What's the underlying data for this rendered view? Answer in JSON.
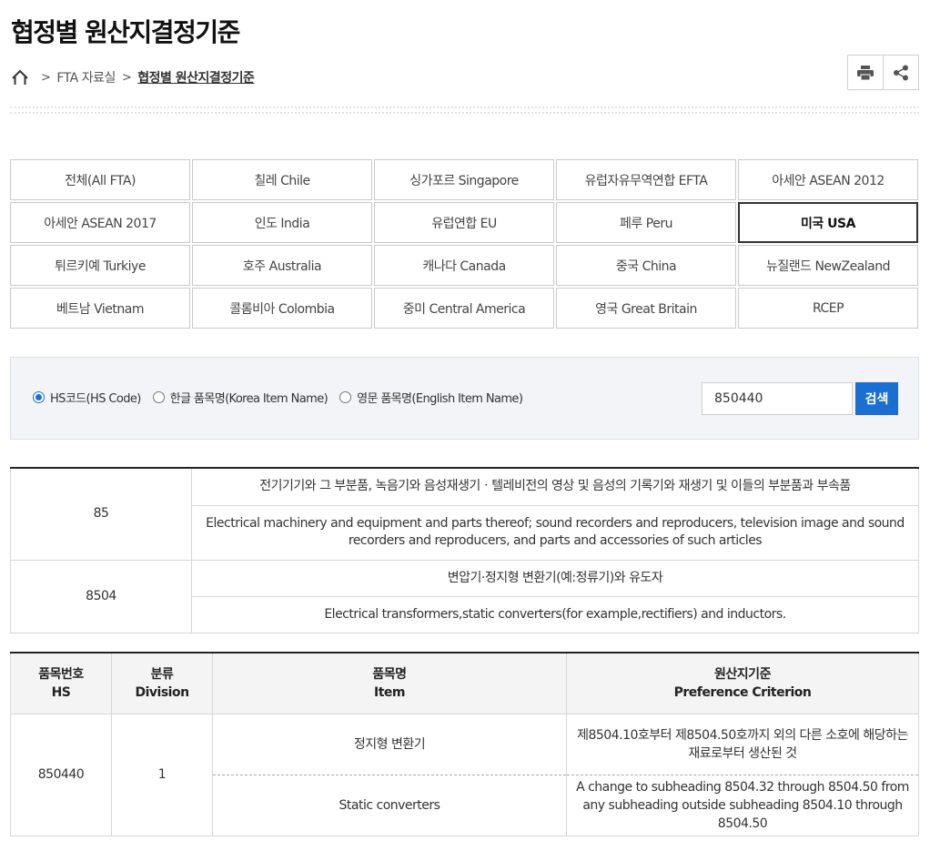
{
  "page_title": "협정별 원산지결정기준",
  "breadcrumb": {
    "home_icon": "home-icon",
    "level1": "FTA 자료실",
    "current": "협정별 원산지결정기준"
  },
  "tools": {
    "print_icon": "print-icon",
    "share_icon": "share-icon"
  },
  "fta_tabs": [
    {
      "label": "전체(All FTA)",
      "active": false
    },
    {
      "label": "칠레 Chile",
      "active": false
    },
    {
      "label": "싱가포르 Singapore",
      "active": false
    },
    {
      "label": "유럽자유무역연합 EFTA",
      "active": false
    },
    {
      "label": "아세안 ASEAN 2012",
      "active": false
    },
    {
      "label": "아세안 ASEAN 2017",
      "active": false
    },
    {
      "label": "인도 India",
      "active": false
    },
    {
      "label": "유럽연합 EU",
      "active": false
    },
    {
      "label": "페루 Peru",
      "active": false
    },
    {
      "label": "미국 USA",
      "active": true
    },
    {
      "label": "튀르키예 Turkiye",
      "active": false
    },
    {
      "label": "호주 Australia",
      "active": false
    },
    {
      "label": "캐나다 Canada",
      "active": false
    },
    {
      "label": "중국 China",
      "active": false
    },
    {
      "label": "뉴질랜드 NewZealand",
      "active": false
    },
    {
      "label": "베트남 Vietnam",
      "active": false
    },
    {
      "label": "콜롬비아 Colombia",
      "active": false
    },
    {
      "label": "중미 Central America",
      "active": false
    },
    {
      "label": "영국 Great Britain",
      "active": false
    },
    {
      "label": "RCEP",
      "active": false
    }
  ],
  "search": {
    "options": [
      {
        "label": "HS코드(HS Code)",
        "checked": true
      },
      {
        "label": "한글 품목명(Korea Item Name)",
        "checked": false
      },
      {
        "label": "영문 품목명(English Item Name)",
        "checked": false
      }
    ],
    "value": "850440",
    "button_label": "검색",
    "accent_color": "#1a6fd0"
  },
  "hs_info": [
    {
      "code": "85",
      "korean": "전기기기와 그 부분품, 녹음기와 음성재생기ㆍ텔레비전의 영상 및 음성의 기록기와 재생기 및 이들의 부분품과 부속품",
      "english": "Electrical machinery and equipment and parts thereof; sound recorders and reproducers, television image and sound recorders and reproducers, and parts and accessories of such articles"
    },
    {
      "code": "8504",
      "korean": "변압기·정지형 변환기(예:정류기)와 유도자",
      "english": "Electrical transformers,static converters(for example,rectifiers) and inductors."
    }
  ],
  "results": {
    "headers": {
      "hs_ko": "품목번호",
      "hs_en": "HS",
      "division_ko": "분류",
      "division_en": "Division",
      "item_ko": "품목명",
      "item_en": "Item",
      "criterion_ko": "원산지기준",
      "criterion_en": "Preference Criterion"
    },
    "rows": [
      {
        "hs": "850440",
        "division": "1",
        "item_ko": "정지형 변환기",
        "item_en": "Static converters",
        "criterion_ko": "제8504.10호부터 제8504.50호까지 외의 다른 소호에 해당하는 재료로부터 생산된 것",
        "criterion_en": "A change to subheading 8504.32 through 8504.50 from any subheading outside subheading 8504.10 through 8504.50"
      }
    ]
  }
}
